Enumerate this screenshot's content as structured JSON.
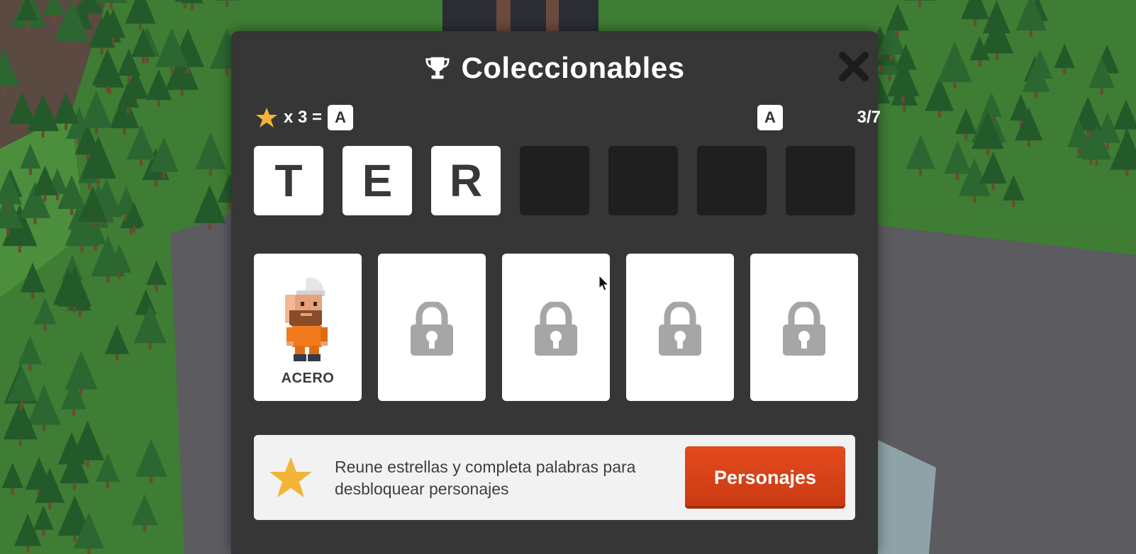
{
  "modal": {
    "title": "Coleccionables",
    "title_icon": "trophy-icon",
    "close_icon": "close-icon"
  },
  "stats": {
    "star_icon": "star-icon",
    "multiplier": "x 3 =",
    "reward_letter": "A",
    "next_letter": "A",
    "progress": "3/7"
  },
  "word": {
    "letters": [
      "T",
      "E",
      "R",
      "",
      "",
      "",
      ""
    ]
  },
  "characters": [
    {
      "name": "ACERO",
      "locked": false
    },
    {
      "name": "",
      "locked": true
    },
    {
      "name": "",
      "locked": true
    },
    {
      "name": "",
      "locked": true
    },
    {
      "name": "",
      "locked": true
    }
  ],
  "footer": {
    "message": "Reune estrellas y completa palabras para desbloquear personajes",
    "button_label": "Personajes"
  },
  "colors": {
    "panel": "#363636",
    "tile_empty": "#1f1f1f",
    "star": "#f2b53a",
    "button": "#d8401a",
    "lock": "#a6a6a6"
  }
}
